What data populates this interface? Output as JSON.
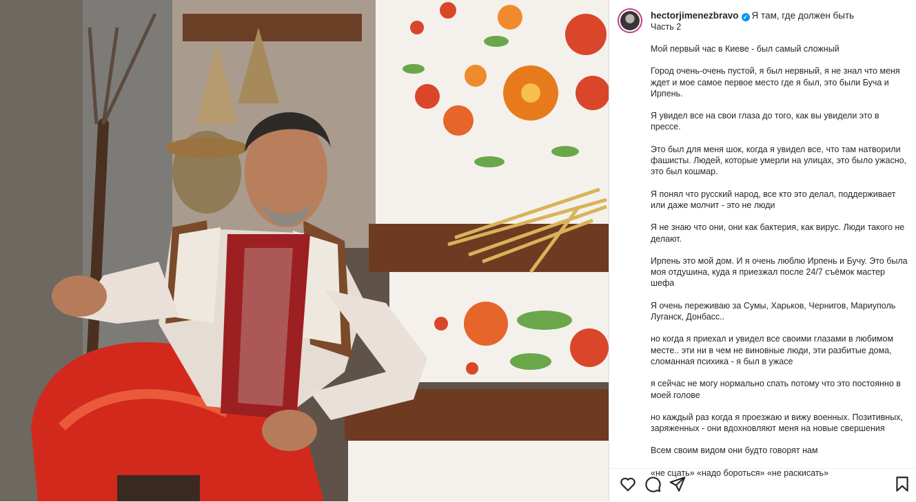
{
  "post": {
    "username": "hectorjimenezbravo",
    "verified_icon": "verified-badge-icon",
    "caption_title": "Я там, где должен быть",
    "subtitle": "Часть 2",
    "paragraphs": [
      "Мой первый час в Киеве - был самый сложный",
      "Город очень-очень пустой, я был нервный, я не знал что меня ждет и мое самое первое место где я был, это были Буча и Ирпень.",
      "Я увидел все на свои глаза до того, как вы увидели это в прессе.",
      "Это был для меня шок, когда я увидел все, что там натворили фашисты. Людей, которые умерли на улицах, это было ужасно, это был кошмар.",
      "Я понял что русский народ, все кто это делал, поддерживает или даже молчит - это не люди",
      "Я не знаю что они, они как бактерия, как вирус. Люди такого не делают.",
      "Ирпень это мой дом. И я очень люблю Ирпень и Бучу. Это была моя отдушина, куда я приезжал после 24/7 съёмок мастер шефа",
      "Я очень переживаю за Сумы, Харьков, Чернигов, Мариуполь Луганск, Донбасс..",
      "но когда я приехал и увидел все своими глазами в любимом месте.. эти ни в чем не виновные люди, эти разбитые дома, сломанная психика - я был в ужасе",
      "я сейчас не могу нормально спать потому что это постоянно в моей голове",
      "но каждый раз когда я проезжаю и вижу военных. Позитивных, заряженных - они вдохновляют меня на новые свершения",
      "Всем своим видом они будто говорят нам",
      "«не сцать» «надо бороться» «не раскисать»"
    ]
  },
  "actions": {
    "like_icon": "heart-icon",
    "comment_icon": "comment-icon",
    "share_icon": "share-icon",
    "save_icon": "bookmark-icon"
  },
  "colors": {
    "verified": "#0095f6",
    "story_ring": "#c23a8a",
    "text": "#262626"
  }
}
